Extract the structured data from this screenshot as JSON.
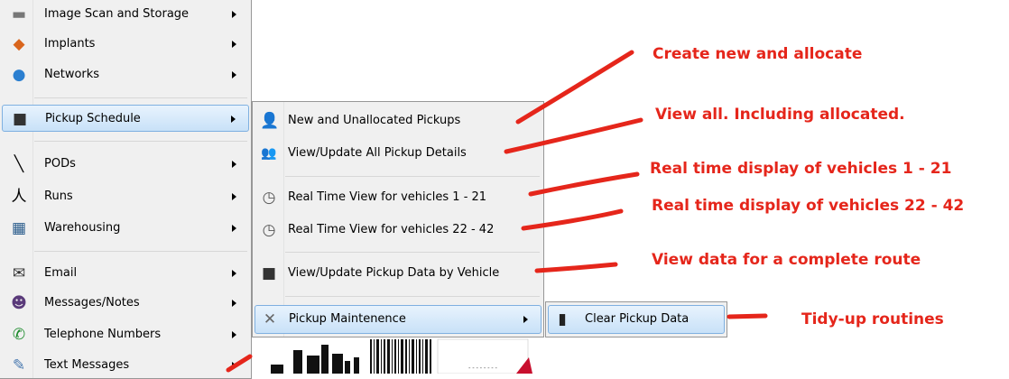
{
  "main_menu": {
    "items": [
      {
        "label": "Image Scan and Storage",
        "icon": "scanner-icon"
      },
      {
        "label": "Implants",
        "icon": "implants-icon"
      },
      {
        "label": "Networks",
        "icon": "globe-icon"
      },
      {
        "label": "Pickup Schedule",
        "icon": "truck-icon",
        "highlighted": true
      },
      {
        "label": "PODs",
        "icon": "pen-icon"
      },
      {
        "label": "Runs",
        "icon": "runner-icon"
      },
      {
        "label": "Warehousing",
        "icon": "warehouse-icon"
      },
      {
        "label": "Email",
        "icon": "envelope-icon"
      },
      {
        "label": "Messages/Notes",
        "icon": "avatar-icon"
      },
      {
        "label": "Telephone Numbers",
        "icon": "phone-icon"
      },
      {
        "label": "Text Messages",
        "icon": "sms-icon"
      }
    ]
  },
  "pickup_submenu": {
    "items": [
      {
        "label": "New and Unallocated Pickups",
        "icon": "person-icon"
      },
      {
        "label": "View/Update All Pickup Details",
        "icon": "people-icon"
      },
      {
        "label": "Real Time View for vehicles 1 - 21",
        "icon": "clock-icon"
      },
      {
        "label": "Real Time View for vehicles 22 - 42",
        "icon": "clock-icon"
      },
      {
        "label": "View/Update Pickup Data by Vehicle",
        "icon": "truck-icon"
      },
      {
        "label": "Pickup Maintenence",
        "icon": "tools-icon",
        "highlighted": true
      }
    ]
  },
  "maintenance_submenu": {
    "items": [
      {
        "label": "Clear Pickup Data",
        "icon": "trash-icon",
        "highlighted": true
      }
    ]
  },
  "annotations": [
    "Create new and allocate",
    "View all. Including allocated.",
    "Real time display of vehicles 1 - 21",
    "Real time display of vehicles 22 - 42",
    "View data for a complete route",
    "Tidy-up routines"
  ],
  "colors": {
    "annotation": "#e5261b",
    "menu_bg": "#f0f0f0",
    "highlight": "#c8e1f8",
    "highlight_border": "#7fb0e0"
  }
}
